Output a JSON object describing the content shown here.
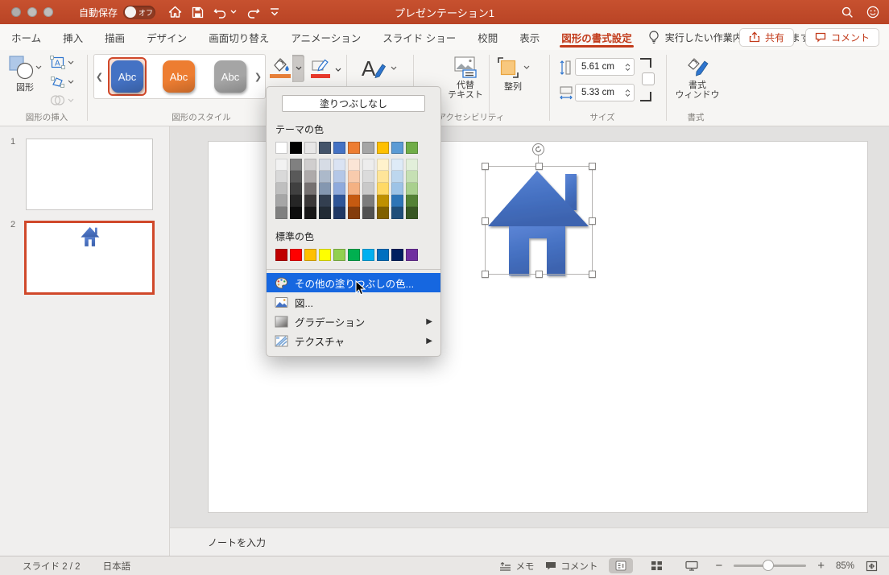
{
  "titlebar": {
    "autosave_label": "自動保存",
    "autosave_state": "オフ",
    "title": "プレゼンテーション1"
  },
  "tabs": {
    "items": [
      "ホーム",
      "挿入",
      "描画",
      "デザイン",
      "画面切り替え",
      "アニメーション",
      "スライド ショー",
      "校閲",
      "表示",
      "図形の書式設定"
    ],
    "active_index": 9,
    "help_text": "実行したい作業内容を入力します",
    "share_label": "共有",
    "comment_label": "コメント"
  },
  "ribbon": {
    "shapes_button": "図形",
    "style_gallery": [
      {
        "label": "Abc",
        "color": "#4472C4",
        "selected": true
      },
      {
        "label": "Abc",
        "color": "#ED7D31",
        "selected": false
      },
      {
        "label": "Abc",
        "color": "#A5A5A5",
        "selected": false
      }
    ],
    "alt_text_lines": [
      "代替",
      "テキスト"
    ],
    "align_button": "整列",
    "size": {
      "height_value": "5.61 cm",
      "width_value": "5.33 cm"
    },
    "format_pane_lines": [
      "書式",
      "ウィンドウ"
    ],
    "group_labels": {
      "insert_shapes": "図形の挿入",
      "shape_styles": "図形のスタイル",
      "accessibility": "アクセシビリティ",
      "size": "サイズ",
      "format": "書式"
    }
  },
  "fill_menu": {
    "no_fill": "塗りつぶしなし",
    "theme_colors_label": "テーマの色",
    "standard_colors_label": "標準の色",
    "theme_colors": [
      "#FFFFFF",
      "#000000",
      "#E7E6E6",
      "#44546A",
      "#4472C4",
      "#ED7D31",
      "#A5A5A5",
      "#FFC000",
      "#5B9BD5",
      "#70AD47"
    ],
    "theme_variants": [
      [
        "#F2F2F2",
        "#808080",
        "#D0CECE",
        "#D6DCE5",
        "#DAE3F3",
        "#FBE5D6",
        "#EDEDED",
        "#FFF2CC",
        "#DEEBF7",
        "#E2EFDA"
      ],
      [
        "#D9D9D9",
        "#595959",
        "#AEAAAA",
        "#ACB9CA",
        "#B4C7E7",
        "#F8CBAD",
        "#DBDBDB",
        "#FFE599",
        "#BDD7EE",
        "#C6E0B4"
      ],
      [
        "#BFBFBF",
        "#404040",
        "#767171",
        "#8497B0",
        "#8FAADC",
        "#F4B183",
        "#C9C9C9",
        "#FFD966",
        "#9DC3E6",
        "#A9D08E"
      ],
      [
        "#A6A6A6",
        "#262626",
        "#3B3838",
        "#333F50",
        "#2F5597",
        "#C55A11",
        "#7C7C7C",
        "#BF9000",
        "#2E75B6",
        "#548235"
      ],
      [
        "#808080",
        "#0D0D0D",
        "#181717",
        "#222B35",
        "#203864",
        "#843C0C",
        "#525252",
        "#806000",
        "#1F4E79",
        "#385723"
      ]
    ],
    "standard_colors": [
      "#C00000",
      "#FF0000",
      "#FFC000",
      "#FFFF00",
      "#92D050",
      "#00B050",
      "#00B0F0",
      "#0070C0",
      "#002060",
      "#7030A0"
    ],
    "items": [
      {
        "label": "その他の塗りつぶしの色...",
        "icon": "palette-icon",
        "highlighted": true,
        "submenu": false
      },
      {
        "label": "図...",
        "icon": "picture-icon",
        "highlighted": false,
        "submenu": false
      },
      {
        "label": "グラデーション",
        "icon": "gradient-icon",
        "highlighted": false,
        "submenu": true
      },
      {
        "label": "テクスチャ",
        "icon": "texture-icon",
        "highlighted": false,
        "submenu": true
      }
    ]
  },
  "slide_panel": {
    "slides": [
      {
        "number": "1"
      },
      {
        "number": "2"
      }
    ],
    "selected_index": 1
  },
  "notes": {
    "placeholder": "ノートを入力"
  },
  "statusbar": {
    "slide_info": "スライド 2 / 2",
    "language": "日本語",
    "memo_label": "メモ",
    "comment_label": "コメント",
    "zoom_level": "85%"
  },
  "colors": {
    "titlebar_red": "#C14A2C",
    "accent_red": "#C23B1B",
    "menu_highlight": "#1667E0",
    "house_blue": "#4472C4",
    "selection_border": "#D0482A"
  }
}
